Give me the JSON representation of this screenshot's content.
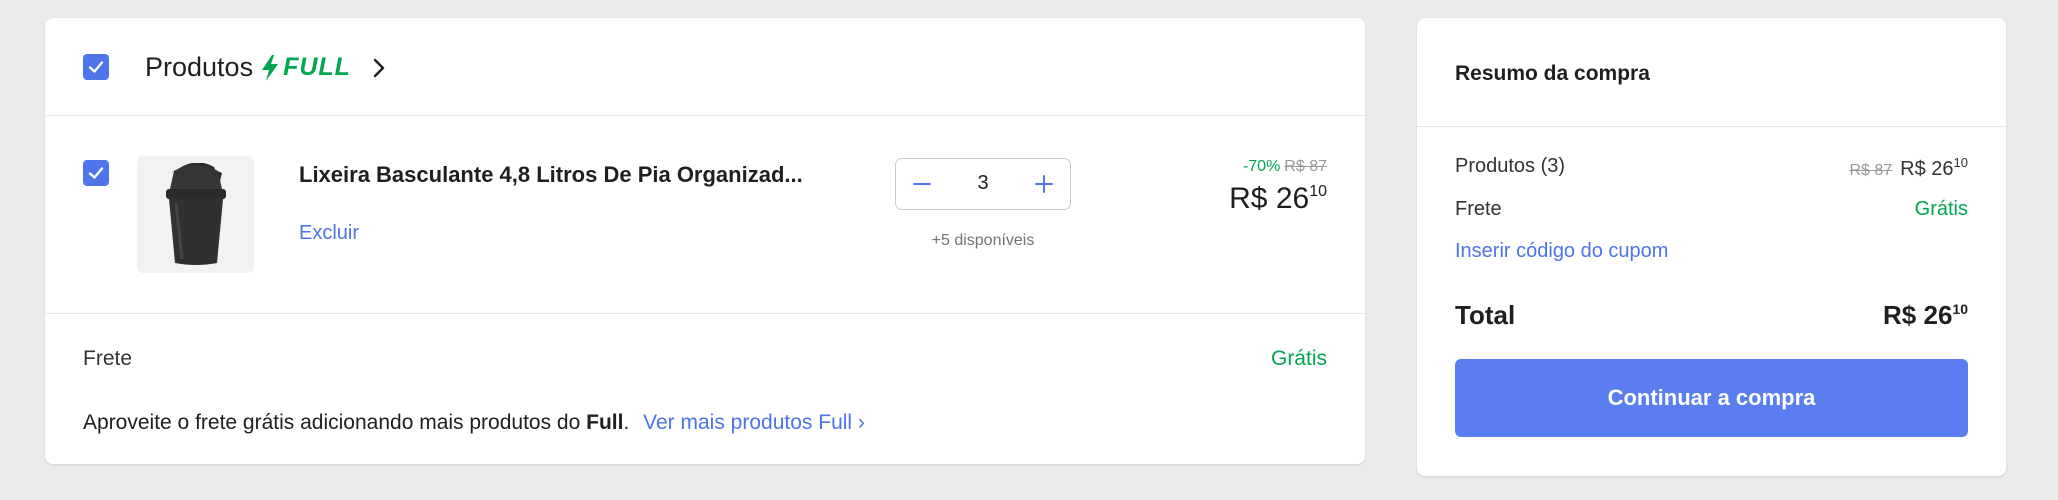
{
  "cart": {
    "header": {
      "title": "Produtos",
      "badge_text": "FULL",
      "badge_color": "#00a650",
      "icons": [
        "check-icon",
        "bolt-icon",
        "chevron-right-icon"
      ]
    },
    "item": {
      "title": "Lixeira Basculante 4,8 Litros De Pia Organizad...",
      "delete_label": "Excluir",
      "quantity": "3",
      "available": "+5 disponíveis",
      "discount": "-70%",
      "old_price": "R$ 87",
      "price_main": "R$ 26",
      "price_cents": "10"
    },
    "shipping": {
      "label": "Frete",
      "value": "Grátis",
      "note_prefix": "Aproveite o frete grátis adicionando mais produtos do",
      "note_bold": "Full",
      "note_suffix": ".",
      "link_label": "Ver mais produtos Full ›"
    }
  },
  "summary": {
    "title": "Resumo da compra",
    "products_label": "Produtos (3)",
    "products_old_price": "R$ 87",
    "products_price_main": "R$ 26",
    "products_price_cents": "10",
    "shipping_label": "Frete",
    "shipping_value": "Grátis",
    "coupon_label": "Inserir código do cupom",
    "total_label": "Total",
    "total_main": "R$ 26",
    "total_cents": "10",
    "continue_label": "Continuar a compra"
  },
  "colors": {
    "accent": "#4f73e8",
    "button": "#5a7ef0",
    "success": "#00a650",
    "background": "#ebebeb"
  }
}
